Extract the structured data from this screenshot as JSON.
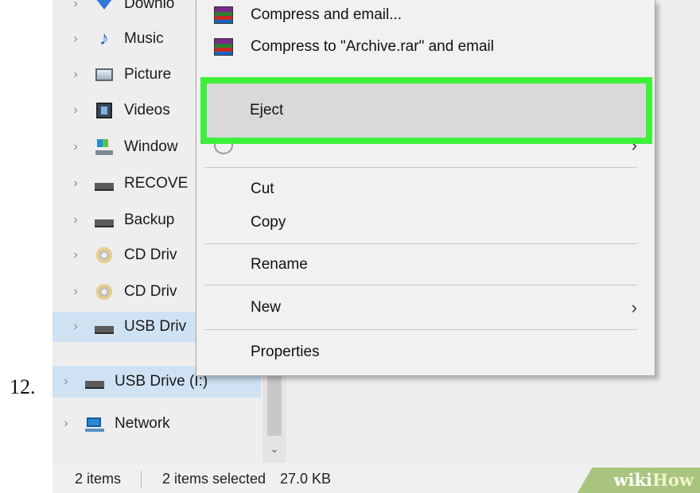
{
  "step": {
    "number": "12."
  },
  "nav": {
    "items": [
      {
        "label": "Downlo",
        "icon": "downloads-icon",
        "name": "nav-item-downloads"
      },
      {
        "label": "Music",
        "icon": "music-icon",
        "name": "nav-item-music"
      },
      {
        "label": "Picture",
        "icon": "pictures-icon",
        "name": "nav-item-pictures"
      },
      {
        "label": "Videos",
        "icon": "videos-icon",
        "name": "nav-item-videos"
      },
      {
        "label": "Window",
        "icon": "windows-drive-icon",
        "name": "nav-item-windows"
      },
      {
        "label": "RECOVE",
        "icon": "drive-icon",
        "name": "nav-item-recovery"
      },
      {
        "label": "Backup",
        "icon": "drive-icon",
        "name": "nav-item-backup"
      },
      {
        "label": "CD Driv",
        "icon": "cd-drive-icon",
        "name": "nav-item-cd-drive-1"
      },
      {
        "label": "CD Driv",
        "icon": "cd-drive-icon",
        "name": "nav-item-cd-drive-2"
      },
      {
        "label": "USB Driv",
        "icon": "usb-drive-icon",
        "name": "nav-item-usb-drive-selected"
      }
    ],
    "usb_drive_label": "USB Drive (I:)",
    "network_label": "Network"
  },
  "context_menu": {
    "compress_email": "Compress and email...",
    "compress_archive_email": "Compress to \"Archive.rar\" and email",
    "eject": "Eject",
    "cut": "Cut",
    "copy": "Copy",
    "rename": "Rename",
    "new": "New",
    "properties": "Properties",
    "submenu_arrow": "›"
  },
  "status_bar": {
    "items": "2 items",
    "selected": "2 items selected",
    "size": "27.0 KB"
  },
  "watermark": {
    "part1": "wiki",
    "part2": "How"
  },
  "colors": {
    "highlight": "#3ef03c",
    "selection": "#cfe2f3"
  }
}
